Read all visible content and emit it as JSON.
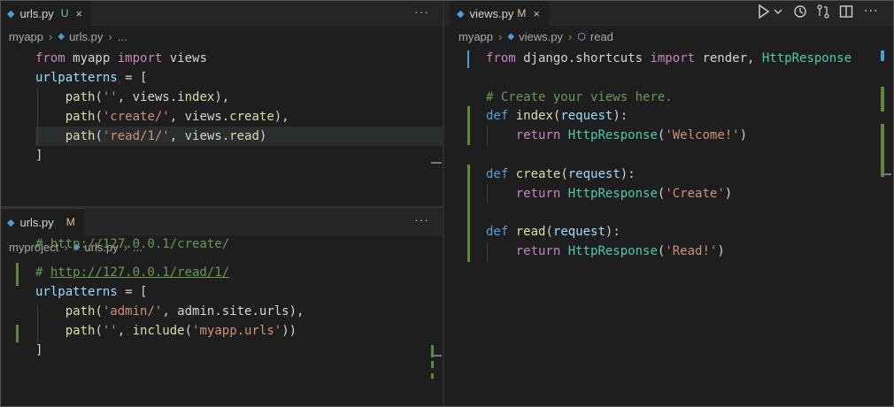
{
  "left_top": {
    "tab": {
      "filename": "urls.py",
      "status": "U",
      "close": "×"
    },
    "more": "···",
    "breadcrumb": {
      "folder": "myapp",
      "file": "urls.py",
      "tail": "..."
    },
    "code": [
      [
        {
          "t": "from",
          "c": "kw-c"
        },
        {
          "t": " myapp ",
          "c": ""
        },
        {
          "t": "import",
          "c": "kw-c"
        },
        {
          "t": " views",
          "c": ""
        }
      ],
      [
        {
          "t": "urlpatterns",
          "c": "var"
        },
        {
          "t": " = [",
          "c": ""
        }
      ],
      [
        {
          "t": "    ",
          "c": ""
        },
        {
          "t": "path",
          "c": "fn"
        },
        {
          "t": "(",
          "c": ""
        },
        {
          "t": "''",
          "c": "str"
        },
        {
          "t": ", views.",
          "c": ""
        },
        {
          "t": "index",
          "c": "fn"
        },
        {
          "t": "),",
          "c": ""
        }
      ],
      [
        {
          "t": "    ",
          "c": ""
        },
        {
          "t": "path",
          "c": "fn"
        },
        {
          "t": "(",
          "c": ""
        },
        {
          "t": "'create/'",
          "c": "str"
        },
        {
          "t": ", views.",
          "c": ""
        },
        {
          "t": "create",
          "c": "fn"
        },
        {
          "t": "),",
          "c": ""
        }
      ],
      [
        {
          "t": "    ",
          "c": ""
        },
        {
          "t": "path",
          "c": "fn"
        },
        {
          "t": "(",
          "c": ""
        },
        {
          "t": "'read/1/'",
          "c": "str"
        },
        {
          "t": ", views.",
          "c": ""
        },
        {
          "t": "read",
          "c": "fn"
        },
        {
          "t": ")",
          "c": ""
        }
      ],
      [
        {
          "t": "]",
          "c": ""
        }
      ]
    ]
  },
  "left_bottom": {
    "tab": {
      "filename": "urls.py",
      "status": "M"
    },
    "more": "···",
    "breadcrumb": {
      "folder": "myproject",
      "file": "urls.py",
      "tail": "..."
    },
    "code": [
      [
        {
          "t": "# http://127.0.0.1/create/",
          "c": "com"
        }
      ],
      [
        {
          "t": "# ",
          "c": "com"
        },
        {
          "t": "http://127.0.0.1/read/1/",
          "c": "com"
        }
      ],
      [
        {
          "t": "urlpatterns",
          "c": "var"
        },
        {
          "t": " = [",
          "c": ""
        }
      ],
      [
        {
          "t": "    ",
          "c": ""
        },
        {
          "t": "path",
          "c": "fn"
        },
        {
          "t": "(",
          "c": ""
        },
        {
          "t": "'admin/'",
          "c": "str"
        },
        {
          "t": ", admin.site.urls),",
          "c": ""
        }
      ],
      [
        {
          "t": "    ",
          "c": ""
        },
        {
          "t": "path",
          "c": "fn"
        },
        {
          "t": "(",
          "c": ""
        },
        {
          "t": "''",
          "c": "str"
        },
        {
          "t": ", ",
          "c": ""
        },
        {
          "t": "include",
          "c": "fn"
        },
        {
          "t": "(",
          "c": ""
        },
        {
          "t": "'myapp.urls'",
          "c": "str"
        },
        {
          "t": "))",
          "c": ""
        }
      ],
      [
        {
          "t": "]",
          "c": ""
        }
      ]
    ]
  },
  "right": {
    "tab": {
      "filename": "views.py",
      "status": "M",
      "close": "×"
    },
    "breadcrumb": {
      "folder": "myapp",
      "file": "views.py",
      "symbol": "read"
    },
    "code": [
      [
        {
          "t": "from",
          "c": "kw-c"
        },
        {
          "t": " django.shortcuts ",
          "c": ""
        },
        {
          "t": "import",
          "c": "kw-c"
        },
        {
          "t": " render, ",
          "c": ""
        },
        {
          "t": "HttpResponse",
          "c": "cls"
        }
      ],
      [],
      [
        {
          "t": "# Create your views here.",
          "c": "com"
        }
      ],
      [
        {
          "t": "def",
          "c": "kw-b"
        },
        {
          "t": " ",
          "c": ""
        },
        {
          "t": "index",
          "c": "fn"
        },
        {
          "t": "(",
          "c": ""
        },
        {
          "t": "request",
          "c": "var"
        },
        {
          "t": "):",
          "c": ""
        }
      ],
      [
        {
          "t": "    ",
          "c": ""
        },
        {
          "t": "return",
          "c": "kw-c"
        },
        {
          "t": " ",
          "c": ""
        },
        {
          "t": "HttpResponse",
          "c": "cls"
        },
        {
          "t": "(",
          "c": ""
        },
        {
          "t": "'Welcome!'",
          "c": "str"
        },
        {
          "t": ")",
          "c": ""
        }
      ],
      [],
      [
        {
          "t": "def",
          "c": "kw-b"
        },
        {
          "t": " ",
          "c": ""
        },
        {
          "t": "create",
          "c": "fn"
        },
        {
          "t": "(",
          "c": ""
        },
        {
          "t": "request",
          "c": "var"
        },
        {
          "t": "):",
          "c": ""
        }
      ],
      [
        {
          "t": "    ",
          "c": ""
        },
        {
          "t": "return",
          "c": "kw-c"
        },
        {
          "t": " ",
          "c": ""
        },
        {
          "t": "HttpResponse",
          "c": "cls"
        },
        {
          "t": "(",
          "c": ""
        },
        {
          "t": "'Create'",
          "c": "str"
        },
        {
          "t": ")",
          "c": ""
        }
      ],
      [],
      [
        {
          "t": "def",
          "c": "kw-b"
        },
        {
          "t": " ",
          "c": ""
        },
        {
          "t": "read",
          "c": "fn"
        },
        {
          "t": "(",
          "c": ""
        },
        {
          "t": "request",
          "c": "var"
        },
        {
          "t": "):",
          "c": ""
        }
      ],
      [
        {
          "t": "    ",
          "c": ""
        },
        {
          "t": "return",
          "c": "kw-c"
        },
        {
          "t": " ",
          "c": ""
        },
        {
          "t": "HttpResponse",
          "c": "cls"
        },
        {
          "t": "(",
          "c": ""
        },
        {
          "t": "'Read!'",
          "c": "str"
        },
        {
          "t": ")",
          "c": ""
        }
      ]
    ],
    "toolbar_icons": [
      "run-icon",
      "run-dropdown-icon",
      "timeline-icon",
      "compare-icon",
      "split-editor-icon",
      "more-actions-icon"
    ]
  },
  "colors": {
    "python_icon": "#4a9eda",
    "git_added": "#5a8a3a",
    "background": "#1e1e1e"
  }
}
